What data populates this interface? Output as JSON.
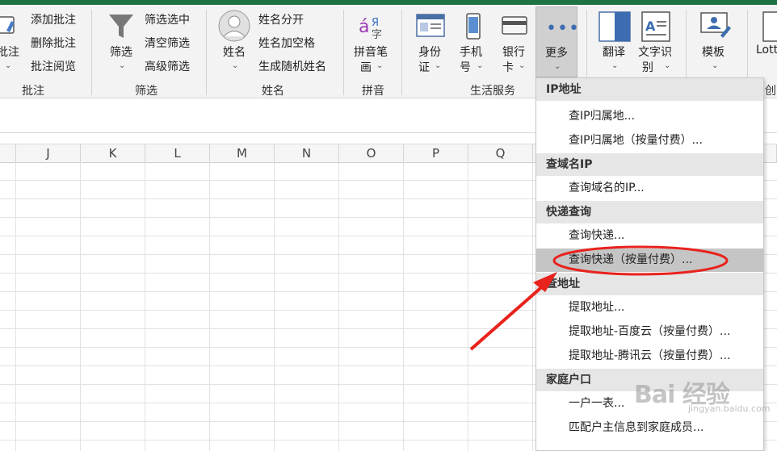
{
  "ribbon": {
    "comment_group": {
      "label": "批注",
      "big_label": "批注",
      "items": [
        "添加批注",
        "删除批注",
        "批注阅览"
      ]
    },
    "filter_group": {
      "label": "筛选",
      "big_label": "筛选",
      "items": [
        "筛选选中",
        "清空筛选",
        "高级筛选"
      ]
    },
    "name_group": {
      "label": "姓名",
      "big_label": "姓名",
      "items": [
        "姓名分开",
        "姓名加空格",
        "生成随机姓名"
      ]
    },
    "pinyin_group": {
      "label": "拼音",
      "big_label_1": "拼音笔",
      "big_label_2": "画"
    },
    "life_group": {
      "label": "生活服务",
      "id_1": "身份",
      "id_2": "证",
      "phone_1": "手机",
      "phone_2": "号",
      "bank_1": "银行",
      "bank_2": "卡",
      "more": "更多"
    },
    "translate": "翻译",
    "ocr_1": "文字识",
    "ocr_2": "别",
    "template": "模板",
    "lottery": "Lotte",
    "partial_right": "创"
  },
  "columns": [
    "J",
    "K",
    "L",
    "M",
    "N",
    "O",
    "P",
    "Q"
  ],
  "menu": {
    "sections": [
      {
        "header": "IP地址",
        "items": [
          "查IP归属地...",
          "查IP归属地（按量付费）..."
        ]
      },
      {
        "header": "查域名IP",
        "items": [
          "查询域名的IP..."
        ]
      },
      {
        "header": "快递查询",
        "items": [
          "查询快递...",
          "查询快递（按量付费）..."
        ]
      },
      {
        "header": "查地址",
        "items": [
          "提取地址...",
          "提取地址-百度云（按量付费）...",
          "提取地址-腾讯云（按量付费）..."
        ]
      },
      {
        "header": "家庭户口",
        "items": [
          "一户一表...",
          "匹配户主信息到家庭成员..."
        ]
      }
    ]
  },
  "watermark": {
    "main": "Bai 经验",
    "sub": "jingyan.baidu.com"
  },
  "colors": {
    "accent_green": "#1f7244",
    "highlight": "#c5c5c5",
    "annotation_red": "#e8221c"
  }
}
